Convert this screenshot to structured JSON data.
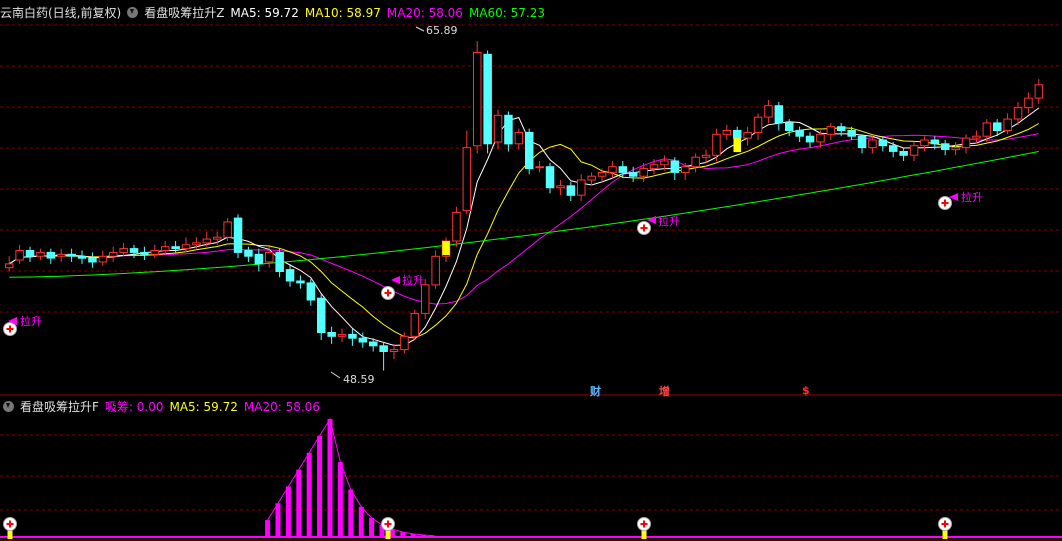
{
  "main_header": {
    "title": "云南白药(日线,前复权)",
    "indicator": "看盘吸筹拉升Z",
    "ma5": "MA5: 59.72",
    "ma10": "MA10: 58.97",
    "ma20": "MA20: 58.06",
    "ma60": "MA60: 57.23"
  },
  "sub_header": {
    "indicator": "看盘吸筹拉升F",
    "xichou": "吸筹: 0.00",
    "ma5": "MA5: 59.72",
    "ma20": "MA20: 58.06"
  },
  "annotations": {
    "high_label": "65.89",
    "low_label": "48.59",
    "signal_label": "拉升",
    "event_cai": "财",
    "event_zeng": "增",
    "event_dollar": "$"
  },
  "colors": {
    "up": "#ff3232",
    "down": "#54ffff",
    "ma5": "#ffffff",
    "ma10": "#ffff00",
    "ma20": "#ff00ff",
    "ma60": "#00ff00",
    "signal": "#ff00ff",
    "grid": "#800000"
  },
  "chart_data": {
    "type": "candlestick",
    "price_range": [
      48,
      67
    ],
    "y_high": 65.89,
    "y_low": 48.59,
    "candles": [
      [
        54.0,
        54.2,
        53.8,
        54.6
      ],
      [
        54.4,
        54.9,
        54.2,
        55.2
      ],
      [
        54.9,
        54.6,
        54.3,
        55.1
      ],
      [
        54.6,
        54.8,
        54.4,
        55.0
      ],
      [
        54.8,
        54.5,
        54.2,
        55.0
      ],
      [
        54.6,
        54.7,
        54.3,
        55.0
      ],
      [
        54.7,
        54.6,
        54.3,
        55.0
      ],
      [
        54.6,
        54.5,
        54.2,
        54.9
      ],
      [
        54.5,
        54.3,
        54.0,
        54.8
      ],
      [
        54.3,
        54.6,
        54.1,
        54.9
      ],
      [
        54.6,
        54.8,
        54.3,
        55.1
      ],
      [
        54.8,
        55.0,
        54.6,
        55.3
      ],
      [
        55.0,
        54.8,
        54.5,
        55.2
      ],
      [
        54.8,
        54.7,
        54.4,
        55.1
      ],
      [
        54.7,
        54.9,
        54.5,
        55.2
      ],
      [
        54.9,
        55.1,
        54.7,
        55.4
      ],
      [
        55.1,
        55.0,
        54.8,
        55.4
      ],
      [
        55.0,
        55.2,
        54.8,
        55.6
      ],
      [
        55.2,
        55.3,
        55.0,
        55.6
      ],
      [
        55.3,
        55.5,
        55.1,
        55.9
      ],
      [
        55.5,
        55.6,
        55.2,
        55.9
      ],
      [
        55.6,
        56.4,
        55.4,
        56.6
      ],
      [
        56.6,
        54.8,
        54.5,
        56.8
      ],
      [
        54.9,
        54.6,
        54.3,
        55.1
      ],
      [
        54.7,
        54.2,
        53.8,
        55.0
      ],
      [
        54.3,
        54.8,
        54.0,
        55.1
      ],
      [
        54.8,
        53.8,
        53.5,
        55.0
      ],
      [
        53.9,
        53.3,
        53.0,
        54.2
      ],
      [
        53.3,
        53.2,
        52.9,
        53.6
      ],
      [
        53.2,
        52.3,
        52.0,
        53.4
      ],
      [
        52.4,
        50.6,
        50.2,
        52.6
      ],
      [
        50.6,
        50.4,
        50.0,
        50.9
      ],
      [
        50.4,
        50.5,
        50.1,
        50.8
      ],
      [
        50.5,
        50.3,
        49.9,
        50.8
      ],
      [
        50.3,
        50.1,
        49.8,
        50.6
      ],
      [
        50.1,
        49.9,
        49.6,
        50.3
      ],
      [
        49.9,
        49.6,
        48.6,
        50.1
      ],
      [
        49.6,
        49.7,
        49.2,
        50.0
      ],
      [
        49.7,
        50.4,
        49.5,
        50.6
      ],
      [
        50.4,
        51.6,
        50.2,
        51.8
      ],
      [
        51.6,
        53.1,
        51.3,
        53.4
      ],
      [
        53.1,
        54.6,
        52.9,
        54.9
      ],
      [
        54.6,
        55.4,
        54.3,
        55.6
      ],
      [
        55.4,
        56.9,
        55.1,
        57.2
      ],
      [
        57.0,
        60.3,
        56.8,
        61.2
      ],
      [
        60.4,
        65.3,
        60.0,
        65.89
      ],
      [
        65.2,
        60.5,
        60.0,
        65.4
      ],
      [
        60.6,
        62.0,
        60.2,
        62.3
      ],
      [
        62.0,
        60.5,
        60.1,
        62.2
      ],
      [
        60.5,
        61.1,
        60.2,
        61.3
      ],
      [
        61.1,
        59.2,
        58.9,
        61.3
      ],
      [
        59.3,
        59.3,
        59.0,
        59.6
      ],
      [
        59.3,
        58.2,
        57.9,
        59.5
      ],
      [
        58.2,
        58.3,
        57.8,
        58.6
      ],
      [
        58.3,
        57.8,
        57.5,
        58.5
      ],
      [
        57.8,
        58.6,
        57.5,
        58.9
      ],
      [
        58.6,
        58.8,
        58.3,
        59.0
      ],
      [
        58.8,
        59.0,
        58.5,
        59.2
      ],
      [
        59.0,
        59.3,
        58.7,
        59.6
      ],
      [
        59.3,
        59.0,
        58.7,
        59.6
      ],
      [
        59.0,
        58.8,
        58.5,
        59.3
      ],
      [
        58.8,
        59.2,
        58.5,
        59.5
      ],
      [
        59.2,
        59.4,
        58.9,
        59.7
      ],
      [
        59.4,
        59.6,
        59.1,
        59.9
      ],
      [
        59.6,
        59.0,
        58.6,
        59.8
      ],
      [
        59.0,
        59.3,
        58.6,
        59.5
      ],
      [
        59.3,
        59.8,
        59.0,
        60.0
      ],
      [
        59.8,
        59.9,
        59.5,
        60.2
      ],
      [
        59.9,
        61.0,
        59.6,
        61.3
      ],
      [
        61.0,
        61.2,
        60.7,
        61.5
      ],
      [
        61.2,
        60.8,
        60.5,
        61.4
      ],
      [
        60.8,
        61.1,
        60.4,
        61.4
      ],
      [
        61.1,
        61.9,
        60.7,
        62.1
      ],
      [
        61.9,
        62.5,
        61.6,
        62.8
      ],
      [
        62.5,
        61.6,
        61.2,
        62.7
      ],
      [
        61.6,
        61.2,
        60.9,
        61.8
      ],
      [
        61.2,
        60.9,
        60.6,
        61.4
      ],
      [
        60.9,
        60.6,
        60.3,
        61.1
      ],
      [
        60.6,
        61.0,
        60.3,
        61.2
      ],
      [
        61.0,
        61.4,
        60.7,
        61.6
      ],
      [
        61.4,
        61.2,
        60.9,
        61.6
      ],
      [
        61.2,
        60.9,
        60.7,
        61.4
      ],
      [
        60.9,
        60.3,
        60.0,
        61.0
      ],
      [
        60.3,
        60.7,
        60.0,
        60.9
      ],
      [
        60.7,
        60.4,
        60.1,
        60.9
      ],
      [
        60.4,
        60.1,
        59.8,
        60.6
      ],
      [
        60.1,
        59.9,
        59.6,
        60.3
      ],
      [
        59.9,
        60.4,
        59.6,
        60.6
      ],
      [
        60.4,
        60.7,
        60.1,
        60.9
      ],
      [
        60.7,
        60.5,
        60.2,
        60.9
      ],
      [
        60.5,
        60.2,
        59.9,
        60.7
      ],
      [
        60.2,
        60.3,
        59.9,
        60.6
      ],
      [
        60.3,
        60.8,
        60.0,
        61.0
      ],
      [
        60.8,
        60.9,
        60.5,
        61.2
      ],
      [
        60.9,
        61.6,
        60.6,
        61.8
      ],
      [
        61.6,
        61.2,
        60.9,
        61.8
      ],
      [
        61.2,
        61.8,
        61.0,
        62.1
      ],
      [
        61.8,
        62.4,
        61.5,
        62.7
      ],
      [
        62.4,
        62.9,
        62.1,
        63.2
      ],
      [
        62.9,
        63.6,
        62.6,
        63.9
      ]
    ]
  }
}
